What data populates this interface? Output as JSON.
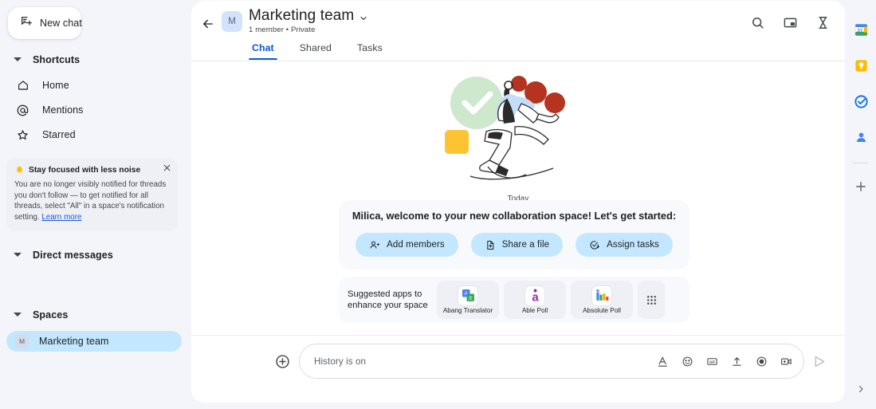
{
  "sidebar": {
    "new_chat": {
      "label": "New chat",
      "icon": "new-chat-icon"
    },
    "shortcuts": {
      "title": "Shortcuts",
      "items": [
        {
          "label": "Home",
          "icon": "home-icon"
        },
        {
          "label": "Mentions",
          "icon": "at-mention-icon"
        },
        {
          "label": "Starred",
          "icon": "star-icon"
        }
      ]
    },
    "banner": {
      "icon": "bell-icon",
      "title": "Stay focused with less noise",
      "body": "You are no longer visibly notified for threads you don't follow — to get notified for all threads, select \"All\" in a space's notification setting.",
      "link": "Learn more",
      "close_icon": "close-icon"
    },
    "direct_messages": {
      "title": "Direct messages"
    },
    "spaces": {
      "title": "Spaces",
      "items": [
        {
          "label": "Marketing team",
          "avatar": "M",
          "selected": true
        }
      ]
    }
  },
  "header": {
    "back_icon": "back-arrow-icon",
    "avatar": "M",
    "title": "Marketing team",
    "chevron_icon": "chevron-down-icon",
    "subtitle": "1 member  •  Private",
    "actions": [
      {
        "name": "search-icon"
      },
      {
        "name": "picture-in-picture-icon"
      },
      {
        "name": "hourglass-icon"
      }
    ],
    "tabs": [
      {
        "label": "Chat",
        "active": true
      },
      {
        "label": "Shared",
        "active": false
      },
      {
        "label": "Tasks",
        "active": false
      }
    ]
  },
  "main": {
    "illustration": "welcome-illustration",
    "date_divider": "Today",
    "welcome": {
      "text": "Milica, welcome to your new collaboration space! Let's get started:",
      "actions": [
        {
          "label": "Add members",
          "icon": "add-members-icon"
        },
        {
          "label": "Share a file",
          "icon": "share-file-icon"
        },
        {
          "label": "Assign tasks",
          "icon": "assign-tasks-icon"
        }
      ]
    },
    "suggested_apps": {
      "label": "Suggested apps to enhance your space",
      "apps": [
        {
          "name": "Abang Translator",
          "icon": "abang-translator-icon"
        },
        {
          "name": "Able Poll",
          "icon": "able-poll-icon"
        },
        {
          "name": "Absolute Poll",
          "icon": "absolute-poll-icon"
        }
      ],
      "more_icon": "apps-grid-icon"
    },
    "composer": {
      "plus_icon": "add-attachment-icon",
      "placeholder": "History is on",
      "value": "",
      "icons": [
        {
          "name": "text-format-icon"
        },
        {
          "name": "emoji-icon"
        },
        {
          "name": "gif-icon"
        },
        {
          "name": "upload-icon"
        },
        {
          "name": "record-icon"
        },
        {
          "name": "video-icon"
        }
      ],
      "send_icon": "send-icon"
    }
  },
  "right_rail": {
    "items": [
      {
        "name": "google-calendar-icon"
      },
      {
        "name": "google-keep-icon"
      },
      {
        "name": "google-tasks-icon"
      },
      {
        "name": "google-contacts-icon"
      }
    ],
    "add_icon": "add-apps-icon",
    "expand_icon": "expand-panel-icon"
  },
  "colors": {
    "accent_blue": "#0b57d0",
    "pill_blue": "#c2e7ff",
    "sidebar_bg": "#f4f5fa",
    "card_bg": "#f8f9fd",
    "link_blue": "#1a56db"
  }
}
